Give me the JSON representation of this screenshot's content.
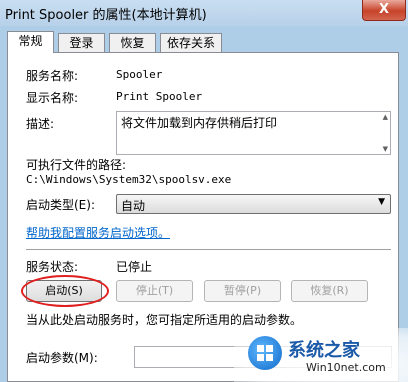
{
  "window": {
    "title": "Print Spooler 的属性(本地计算机)",
    "close_label": "X"
  },
  "tabs": [
    {
      "label": "常规",
      "active": true
    },
    {
      "label": "登录",
      "active": false
    },
    {
      "label": "恢复",
      "active": false
    },
    {
      "label": "依存关系",
      "active": false
    }
  ],
  "general": {
    "service_name_label": "服务名称:",
    "service_name_value": "Spooler",
    "display_name_label": "显示名称:",
    "display_name_value": "Print Spooler",
    "description_label": "描述:",
    "description_value": "将文件加载到内存供稍后打印",
    "exe_path_label": "可执行文件的路径:",
    "exe_path_value": "C:\\Windows\\System32\\spoolsv.exe",
    "startup_type_label": "启动类型(E):",
    "startup_type_value": "自动",
    "help_link": "帮助我配置服务启动选项。",
    "status_label": "服务状态:",
    "status_value": "已停止",
    "buttons": {
      "start": "启动(S)",
      "stop": "停止(T)",
      "pause": "暂停(P)",
      "resume": "恢复(R)"
    },
    "hint_text": "当从此处启动服务时，您可指定所适用的启动参数。",
    "start_params_label": "启动参数(M):",
    "start_params_value": ""
  },
  "watermark": {
    "name": "系统之家",
    "url": "Win10net.com"
  },
  "colors": {
    "link": "#0066cc",
    "highlight_ring": "#e02020",
    "close_button": "#c7432a"
  }
}
